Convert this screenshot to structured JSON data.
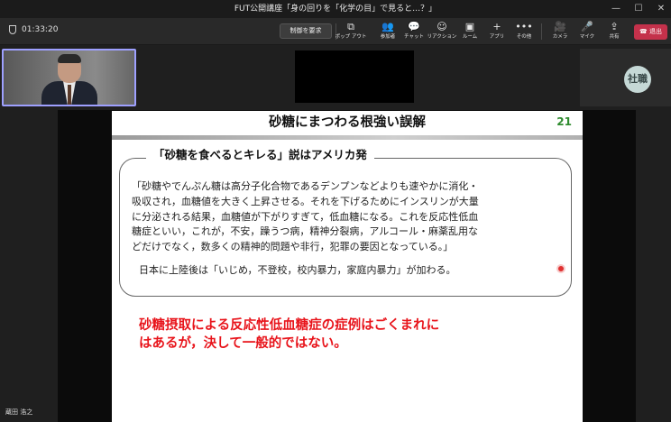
{
  "window": {
    "title": "FUT公開講座「身の回りを「化学の目」で見ると…？」"
  },
  "toolbar": {
    "timer": "01:33:20",
    "control_button": "制御を要求",
    "items": [
      {
        "icon": "popout-icon",
        "glyph": "⧉",
        "label": "ポップ アウト"
      },
      {
        "icon": "participants-icon",
        "glyph": "👥",
        "label": "参加者"
      },
      {
        "icon": "chat-icon",
        "glyph": "💬",
        "label": "チャット"
      },
      {
        "icon": "reaction-icon",
        "glyph": "☺",
        "label": "リアクション"
      },
      {
        "icon": "rooms-icon",
        "glyph": "▣",
        "label": "ルーム"
      },
      {
        "icon": "apps-icon",
        "glyph": "+",
        "label": "アプリ"
      },
      {
        "icon": "more-icon",
        "glyph": "•••",
        "label": "その他"
      },
      {
        "icon": "camera-icon",
        "glyph": "🎥",
        "label": "カメラ"
      },
      {
        "icon": "mic-icon",
        "glyph": "🎤",
        "label": "マイク"
      },
      {
        "icon": "share-icon",
        "glyph": "⇪",
        "label": "共有"
      }
    ],
    "leave_label": "退出"
  },
  "participants": {
    "avatar_initials": "社職",
    "presenter_name": "蔵田 浩之"
  },
  "slide": {
    "title": "砂糖にまつわる根強い誤解",
    "number": "21",
    "quote_heading": "「砂糖を食べるとキレる」説はアメリカ発",
    "quote_lines": [
      "「砂糖やでんぷん糖は高分子化合物であるデンプンなどよりも速やかに消化・",
      "吸収され，血糖値を大きく上昇させる。それを下げるためにインスリンが大量",
      "に分泌される結果，血糖値が下がりすぎて，低血糖になる。これを反応性低血",
      "糖症といい，これが，不安，躁うつ病，精神分裂病，アルコール・麻薬乱用な",
      "どだけでなく，数多くの精神的問題や非行，犯罪の要因となっている。」"
    ],
    "quote_foot": "日本に上陸後は「いじめ，不登校，校内暴力，家庭内暴力」が加わる。",
    "conclusion_lines": [
      "砂糖摂取による反応性低血糖症の症例はごくまれに",
      "はあるが，決して一般的ではない。"
    ]
  }
}
